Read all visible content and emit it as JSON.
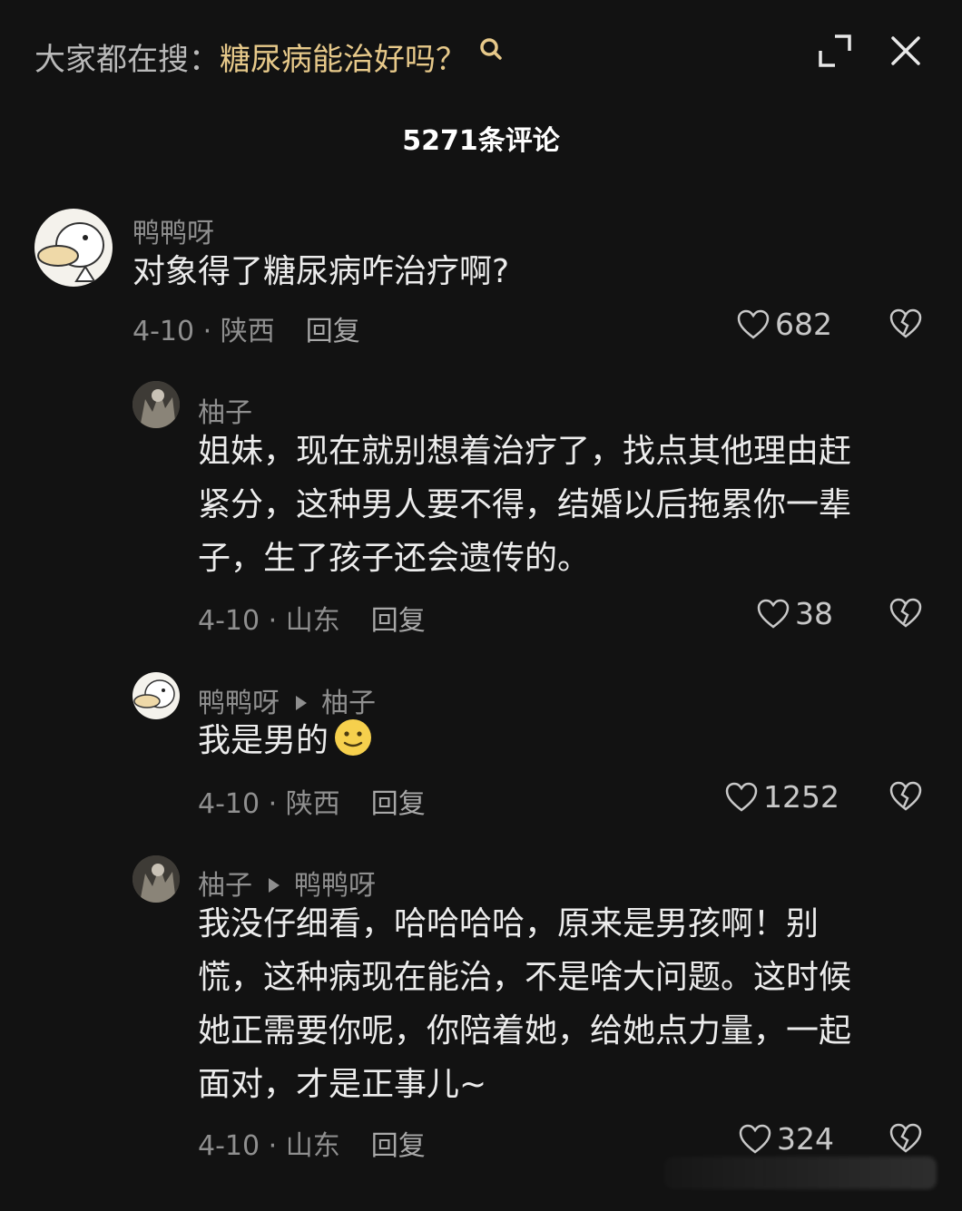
{
  "header": {
    "search_prefix": "大家都在搜：",
    "search_query": "糖尿病能治好吗？",
    "comments_count": "5271条评论"
  },
  "comments": [
    {
      "user": "鸭鸭呀",
      "text": "对象得了糖尿病咋治疗啊?",
      "date_location": "4-10 · 陕西",
      "reply_label": "回复",
      "likes": "682"
    },
    {
      "user": "柚子",
      "text": "姐妹，现在就别想着治疗了，找点其他理由赶紧分，这种男人要不得，结婚以后拖累你一辈子，生了孩子还会遗传的。",
      "date_location": "4-10 · 山东",
      "reply_label": "回复",
      "likes": "38"
    },
    {
      "user": "鸭鸭呀",
      "reply_to": "柚子",
      "text": "我是男的",
      "emoji": "slightly-smiling-face-emoji",
      "date_location": "4-10 · 陕西",
      "reply_label": "回复",
      "likes": "1252"
    },
    {
      "user": "柚子",
      "reply_to": "鸭鸭呀",
      "text": "我没仔细看，哈哈哈哈，原来是男孩啊！别慌，这种病现在能治，不是啥大问题。这时候她正需要你呢，你陪着她，给她点力量，一起面对，才是正事儿~",
      "date_location": "4-10 · 山东",
      "reply_label": "回复",
      "likes": "324"
    }
  ],
  "colors": {
    "background": "#121212",
    "query_accent": "#e7c98a",
    "muted_text": "#8f8f8f",
    "body_text": "#ececec"
  },
  "icons": [
    "search-icon",
    "expand-icon",
    "close-icon",
    "heart-icon",
    "broken-heart-icon",
    "avatar-duck",
    "avatar-photo"
  ]
}
